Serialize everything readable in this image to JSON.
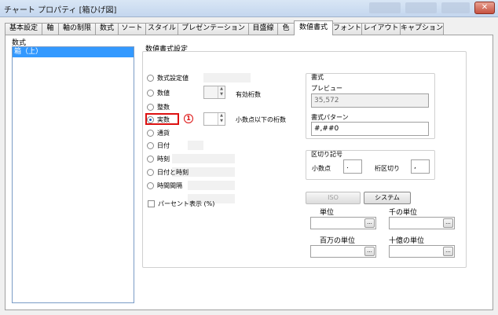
{
  "window": {
    "title": "チャート プロパティ [箱ひげ図]",
    "close_label": "✕"
  },
  "tabs": [
    {
      "label": "基本設定"
    },
    {
      "label": "軸"
    },
    {
      "label": "軸の制限"
    },
    {
      "label": "数式"
    },
    {
      "label": "ソート"
    },
    {
      "label": "スタイル"
    },
    {
      "label": "プレゼンテーション"
    },
    {
      "label": "目盛線"
    },
    {
      "label": "色"
    },
    {
      "label": "数値書式"
    },
    {
      "label": "フォント"
    },
    {
      "label": "レイアウト"
    },
    {
      "label": "キャプション"
    }
  ],
  "active_tab": "数値書式",
  "left": {
    "label": "数式",
    "items": [
      "箱（上）"
    ]
  },
  "number_format": {
    "group_label": "数値書式設定",
    "options": [
      {
        "label": "数式設定値",
        "selected": false
      },
      {
        "label": "数値",
        "selected": false
      },
      {
        "label": "整数",
        "selected": false
      },
      {
        "label": "実数",
        "selected": true
      },
      {
        "label": "通貨",
        "selected": false
      },
      {
        "label": "日付",
        "selected": false
      },
      {
        "label": "時刻",
        "selected": false
      },
      {
        "label": "日付と時刻",
        "selected": false
      },
      {
        "label": "時間間隔",
        "selected": false
      }
    ],
    "significant_digits_label": "有効桁数",
    "decimal_places_label": "小数点以下の桁数",
    "percent_label": "パーセント表示 (%)",
    "marker": "1"
  },
  "format_box": {
    "title": "書式",
    "preview_label": "プレビュー",
    "preview_value": "35,572",
    "pattern_label": "書式パターン",
    "pattern_value": "#,##0"
  },
  "separator_box": {
    "title": "区切り記号",
    "decimal_label": "小数点",
    "decimal_value": ".",
    "thousands_label": "桁区切り",
    "thousands_value": ","
  },
  "buttons": {
    "iso": "ISO",
    "system": "システム"
  },
  "units": {
    "thousand": "千の単位",
    "unit": "単位",
    "million": "百万の単位",
    "billion": "十億の単位",
    "browse": "..."
  }
}
